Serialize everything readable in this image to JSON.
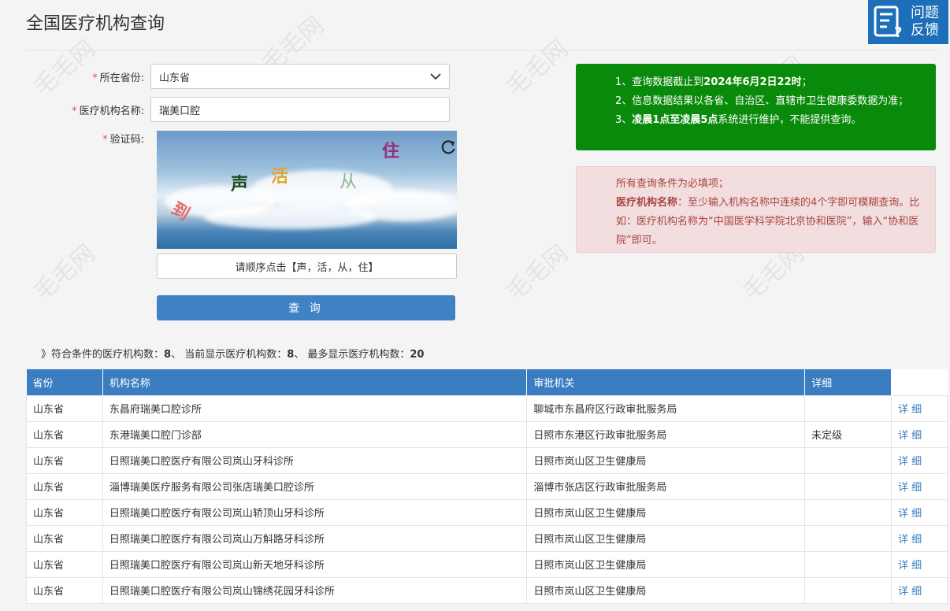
{
  "page": {
    "title": "全国医疗机构查询"
  },
  "feedback": {
    "line1": "问题",
    "line2": "反馈"
  },
  "form": {
    "province_label": "所在省份:",
    "province_value": "山东省",
    "name_label": "医疗机构名称:",
    "name_value": "瑞美口腔",
    "captcha_label": "验证码:",
    "captcha_chars": [
      "到",
      "声",
      "活",
      "从",
      "住"
    ],
    "captcha_hint": "请顺序点击【声，活，从，住】",
    "query_label": "查 询",
    "required_mark": "*"
  },
  "notice_green": {
    "line1_prefix": "1、查询数据截止到",
    "line1_bold": "2024年6月2日22时",
    "line1_suffix": "；",
    "line2": "2、信息数据结果以各省、自治区、直辖市卫生健康委数据为准；",
    "line3_prefix": "3、",
    "line3_bold": "凌晨1点至凌晨5点",
    "line3_suffix": "系统进行维护，不能提供查询。"
  },
  "notice_red": {
    "line1": "所有查询条件为必填项；",
    "line2_bold": "医疗机构名称",
    "line2_rest": "：至少输入机构名称中连续的4个字即可模糊查询。比如：医疗机构名称为“中国医学科学院北京协和医院”，输入“协和医院”即可。"
  },
  "summary": {
    "prefix": "》符合条件的医疗机构数：",
    "match_count": "8",
    "sep1": "、 当前显示医疗机构数：",
    "shown_count": "8",
    "sep2": "、 最多显示医疗机构数：",
    "max_count": "20"
  },
  "table": {
    "headers": [
      "省份",
      "机构名称",
      "审批机关",
      "详细"
    ],
    "rows": [
      {
        "province": "山东省",
        "name": "东昌府瑞美口腔诊所",
        "authority": "聊城市东昌府区行政审批服务局",
        "level": "",
        "detail": "详 细"
      },
      {
        "province": "山东省",
        "name": "东港瑞美口腔门诊部",
        "authority": "日照市东港区行政审批服务局",
        "level": "未定级",
        "detail": "详 细"
      },
      {
        "province": "山东省",
        "name": "日照瑞美口腔医疗有限公司岚山牙科诊所",
        "authority": "日照市岚山区卫生健康局",
        "level": "",
        "detail": "详 细"
      },
      {
        "province": "山东省",
        "name": "淄博瑞美医疗服务有限公司张店瑞美口腔诊所",
        "authority": "淄博市张店区行政审批服务局",
        "level": "",
        "detail": "详 细"
      },
      {
        "province": "山东省",
        "name": "日照瑞美口腔医疗有限公司岚山轿顶山牙科诊所",
        "authority": "日照市岚山区卫生健康局",
        "level": "",
        "detail": "详 细"
      },
      {
        "province": "山东省",
        "name": "日照瑞美口腔医疗有限公司岚山万斛路牙科诊所",
        "authority": "日照市岚山区卫生健康局",
        "level": "",
        "detail": "详 细"
      },
      {
        "province": "山东省",
        "name": "日照瑞美口腔医疗有限公司岚山新天地牙科诊所",
        "authority": "日照市岚山区卫生健康局",
        "level": "",
        "detail": "详 细"
      },
      {
        "province": "山东省",
        "name": "日照瑞美口腔医疗有限公司岚山锦绣花园牙科诊所",
        "authority": "日照市岚山区卫生健康局",
        "level": "",
        "detail": "详 细"
      }
    ]
  },
  "watermark_text": "毛毛网",
  "colors": {
    "primary": "#3b7dc1",
    "success": "#0a8a0a",
    "danger_bg": "#f2dede",
    "danger_text": "#a94442"
  }
}
